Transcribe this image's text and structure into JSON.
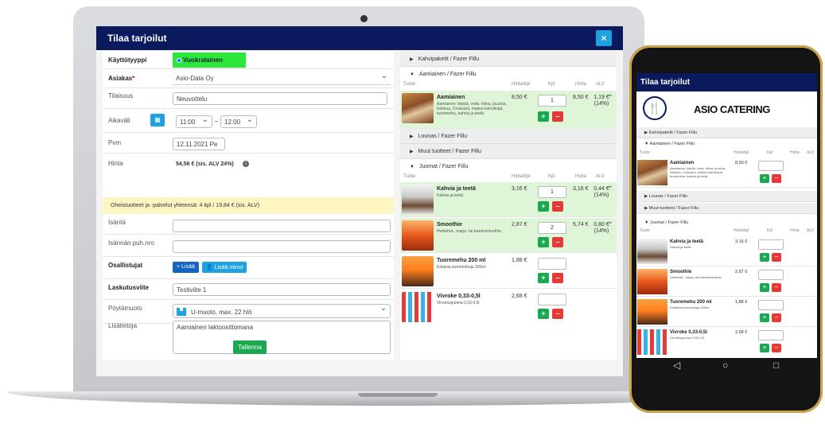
{
  "desktop": {
    "title": "Tilaa tarjoilut",
    "close_label": "×",
    "form": {
      "kayttotyyppi_label": "Käyttötyyppi",
      "kayttotyyppi_value": "Vuokralainen",
      "asiakas_label": "Asiakas",
      "asiakas_required": "*",
      "asiakas_value": "Asio-Data Oy",
      "tilaisuus_label": "Tilaisuus",
      "tilaisuus_value": "Neuvottelu",
      "aikavali_label": "Aikaväli",
      "start_time": "11:00",
      "time_sep": "–",
      "end_time": "12:00",
      "pvm_label": "Pvm",
      "pvm_value": "12.11.2021 Pe",
      "hinta_label": "Hinta",
      "hinta_value": "54,56 € (sis. ALV 24%)",
      "notice": "Oheistuotteet ja -palvelut yhteensä: 4 kpl / 19,84 € (sis. ALV)",
      "isanta_label": "Isäntä",
      "isanta_value": "",
      "isannan_puh_label": "Isännän puh.nro",
      "isannan_puh_value": "",
      "osallistujat_label": "Osallistujat",
      "lisaa_label": "+ Lisää",
      "lisaa_minut_label": "Lisää minut",
      "laskutusviite_label": "Laskutusviite",
      "laskutusviite_value": "Testiviite 1",
      "poytamuoto_label": "Pöytämuoto",
      "poytamuoto_value": "U-muoto, max. 22 hlö",
      "lisatietoja_label": "Lisätietoja",
      "lisatietoja_value": "Aamiainen laktoosittomana",
      "save_label": "Tallenna"
    },
    "products": {
      "categories": [
        "Kahvipaketit / Fazer Fillu",
        "Aamiainen / Fazer Fillu",
        "Lounas / Fazer Fillu",
        "Muut tuotteet / Fazer Fillu",
        "Juomat / Fazer Fillu"
      ],
      "headers": {
        "tuote": "Tuote",
        "hinta_kpl": "Hinta/kpl",
        "kpl": "Kpl",
        "hinta": "Hinta",
        "alv": "ALV"
      },
      "aamiainen": {
        "name": "Aamiainen",
        "desc": "Aamiainen: leipää, voita, hilloa, juustoa, kinkkua, Croissant, makea kahvileipä, tuoremehu, kahvia ja teetä.",
        "price": "8,50 €",
        "qty": "1",
        "total": "8,50 €",
        "alv": "1,19 € (14%)"
      },
      "juomat": [
        {
          "name": "Kahvia ja teetä",
          "desc": "Kahvia ja teetä",
          "price": "3,16 €",
          "qty": "1",
          "total": "3,16 €",
          "alv": "0,44 € (14%)"
        },
        {
          "name": "Smoothie",
          "desc": "Hedelmä-, marja- tai kasvissmoothie.",
          "price": "2,87 €",
          "qty": "2",
          "total": "5,74 €",
          "alv": "0,80 € (14%)"
        },
        {
          "name": "Tuoremehu 200 ml",
          "desc": "Erilaisia tuoremehuja 200ml",
          "price": "1,88 €",
          "qty": "",
          "total": "",
          "alv": ""
        },
        {
          "name": "Vivroke 0,33-0,5l",
          "desc": "Virvoitusjuoma 0,33-0,5l",
          "price": "2,68 €",
          "qty": "",
          "total": "",
          "alv": ""
        }
      ]
    }
  },
  "mobile": {
    "title": "Tilaa tarjoilut",
    "logo_text": "ASIO CATERING",
    "categories": [
      "Kahvipaketit / Fazer Fillu",
      "Aamiainen / Fazer Fillu",
      "Lounas / Fazer Fillu",
      "Muut tuotteet / Fazer Fillu",
      "Juomat / Fazer Fillu"
    ],
    "headers": {
      "tuote": "Tuote",
      "hinta_kpl": "Hinta/kpl",
      "kpl": "Kpl",
      "hinta": "Hinta",
      "alv": "ALV"
    },
    "aamiainen": {
      "name": "Aamiainen",
      "desc": "Aamiainen: leipää, voita, hilloa, juustoa, kinkkua, Croissant, makea kahvileipä, tuoremehu, kahvia ja teetä.",
      "price": "8,50 €"
    },
    "juomat": [
      {
        "name": "Kahvia ja teetä",
        "desc": "Kahvia ja teetä",
        "price": "3,16 €"
      },
      {
        "name": "Smoothie",
        "desc": "Hedelmä-, marja- tai kasvissmoothie.",
        "price": "2,87 €"
      },
      {
        "name": "Tuoremehu 200 ml",
        "desc": "Erilaisia tuoremehuja 200ml",
        "price": "1,88 €"
      },
      {
        "name": "Vivroke 0,33-0,5l",
        "desc": "Virvoitusjuoma 0,33-0,5l",
        "price": "2,68 €"
      }
    ],
    "plus": "+",
    "minus": "–",
    "nav": {
      "back": "◁",
      "home": "○",
      "recents": "□"
    }
  },
  "colors": {
    "header": "#0a1a5c",
    "accent": "#1ea2e0",
    "green": "#1aa850",
    "red": "#e53935",
    "highlight": "#2de63c"
  }
}
